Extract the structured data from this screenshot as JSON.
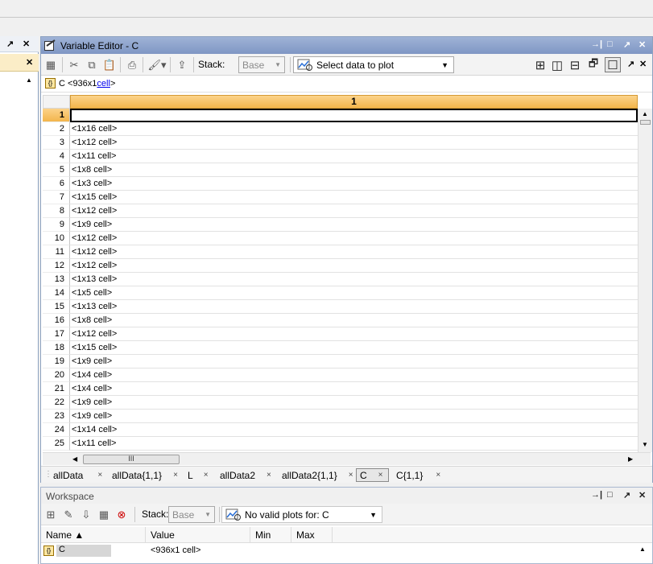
{
  "left_panel": {
    "undock": "↗",
    "close": "✕",
    "close2": "✕",
    "scroll_up": "▲"
  },
  "variable_editor": {
    "title": "Variable Editor - C",
    "title_controls": [
      "→|",
      "□",
      "↗",
      "✕"
    ],
    "toolbar": {
      "stack_label": "Stack:",
      "stack_value": "Base",
      "plot_label": "Select data to plot",
      "layout_icons": [
        "⊞",
        "◫",
        "⊟",
        "🗗",
        "☐"
      ],
      "undock": "↗",
      "close": "✕"
    },
    "path": {
      "var": "C",
      "size": "<936x1",
      "type": "cell",
      "close": ">"
    },
    "column_header": "1",
    "rows": [
      {
        "n": "1",
        "v": ""
      },
      {
        "n": "2",
        "v": "<1x16 cell>"
      },
      {
        "n": "3",
        "v": "<1x12 cell>"
      },
      {
        "n": "4",
        "v": "<1x11 cell>"
      },
      {
        "n": "5",
        "v": "<1x8 cell>"
      },
      {
        "n": "6",
        "v": "<1x3 cell>"
      },
      {
        "n": "7",
        "v": "<1x15 cell>"
      },
      {
        "n": "8",
        "v": "<1x12 cell>"
      },
      {
        "n": "9",
        "v": "<1x9 cell>"
      },
      {
        "n": "10",
        "v": "<1x12 cell>"
      },
      {
        "n": "11",
        "v": "<1x12 cell>"
      },
      {
        "n": "12",
        "v": "<1x12 cell>"
      },
      {
        "n": "13",
        "v": "<1x13 cell>"
      },
      {
        "n": "14",
        "v": "<1x5 cell>"
      },
      {
        "n": "15",
        "v": "<1x13 cell>"
      },
      {
        "n": "16",
        "v": "<1x8 cell>"
      },
      {
        "n": "17",
        "v": "<1x12 cell>"
      },
      {
        "n": "18",
        "v": "<1x15 cell>"
      },
      {
        "n": "19",
        "v": "<1x9 cell>"
      },
      {
        "n": "20",
        "v": "<1x4 cell>"
      },
      {
        "n": "21",
        "v": "<1x4 cell>"
      },
      {
        "n": "22",
        "v": "<1x9 cell>"
      },
      {
        "n": "23",
        "v": "<1x9 cell>"
      },
      {
        "n": "24",
        "v": "<1x14 cell>"
      },
      {
        "n": "25",
        "v": "<1x11 cell>"
      }
    ],
    "scroll": {
      "up": "▲",
      "down": "▼",
      "left": "◀",
      "right": "▶",
      "grip": "III"
    },
    "tabs": [
      {
        "label": "allData",
        "close": "×"
      },
      {
        "label": "allData{1,1}",
        "close": "×"
      },
      {
        "label": "L",
        "close": "×"
      },
      {
        "label": "allData2",
        "close": "×"
      },
      {
        "label": "allData2{1,1}",
        "close": "×"
      },
      {
        "label": "C",
        "close": "×"
      },
      {
        "label": "C{1,1}",
        "close": "×"
      }
    ]
  },
  "workspace": {
    "title": "Workspace",
    "title_controls": [
      "→|",
      "□",
      "↗",
      "✕"
    ],
    "stack_label": "Stack:",
    "stack_value": "Base",
    "plot_label": "No valid plots for: C",
    "columns": [
      "Name ▲",
      "Value",
      "Min",
      "Max"
    ],
    "rows": [
      {
        "name": "C",
        "value": "<936x1 cell>"
      }
    ]
  },
  "colors": {
    "accent": "#f3b54c",
    "title_bar": "#8ea4cc",
    "link": "#0000ee"
  }
}
